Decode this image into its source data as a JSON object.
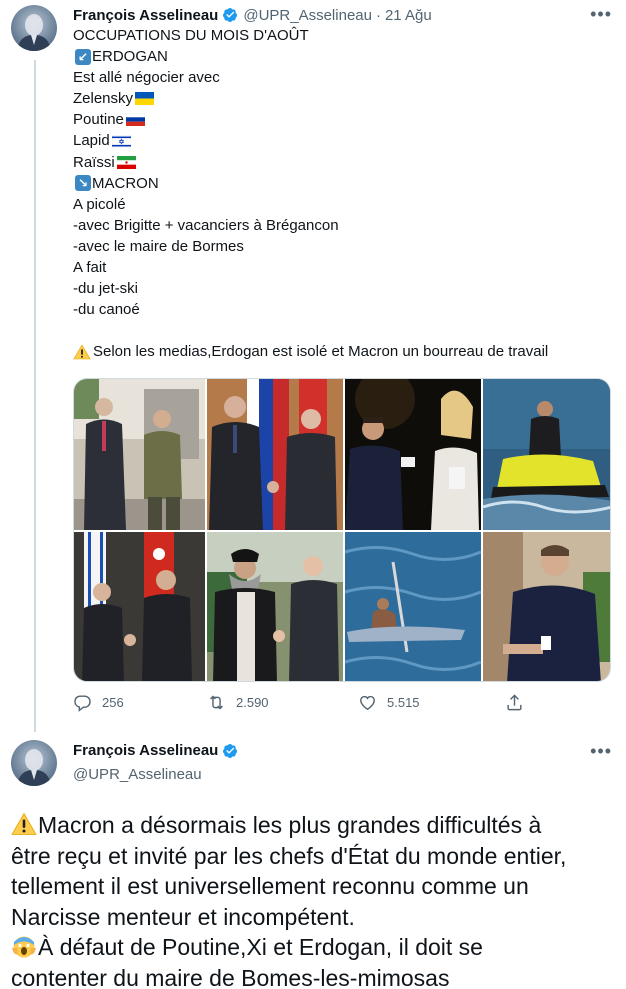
{
  "tweet1": {
    "author_name": "François Asselineau",
    "handle": "@UPR_Asselineau",
    "separator": "·",
    "date": "21 Ağu",
    "more_icon": "more-horizontal-icon",
    "lines": {
      "l1": "OCCUPATIONS DU MOIS D'AOÛT",
      "l2": "ERDOGAN",
      "l3": "Est allé négocier avec",
      "l4": "Zelensky",
      "l5": "Poutine",
      "l6": "Lapid",
      "l7": "Raïssi",
      "l8": "MACRON",
      "l9": "A picolé",
      "l10": "-avec Brigitte + vacanciers à Brégancon",
      "l11": "-avec le maire de Bormes",
      "l12": "A fait",
      "l13": "-du jet-ski",
      "l14": "-du canoé",
      "l15": "Selon les medias,Erdogan est isolé et Macron un bourreau de travail"
    },
    "metrics": {
      "replies": "256",
      "retweets": "2.590",
      "likes": "5.515"
    }
  },
  "tweet2": {
    "author_name": "François Asselineau",
    "handle": "@UPR_Asselineau",
    "lines": {
      "b1": "Macron a désormais les plus grandes difficultés à",
      "b2": "être reçu et invité par les chefs d'État du monde entier,",
      "b3": "tellement il est universellement reconnu comme un",
      "b4": "Narcisse menteur et incompétent.",
      "b5": "À défaut de Poutine,Xi et Erdogan, il doit se",
      "b6": "contenter du maire de Bomes-les-mimosas"
    }
  },
  "colors": {
    "text": "#0f1419",
    "secondary": "#536471",
    "verified": "#1d9bf0",
    "divider": "#cfd9de"
  }
}
